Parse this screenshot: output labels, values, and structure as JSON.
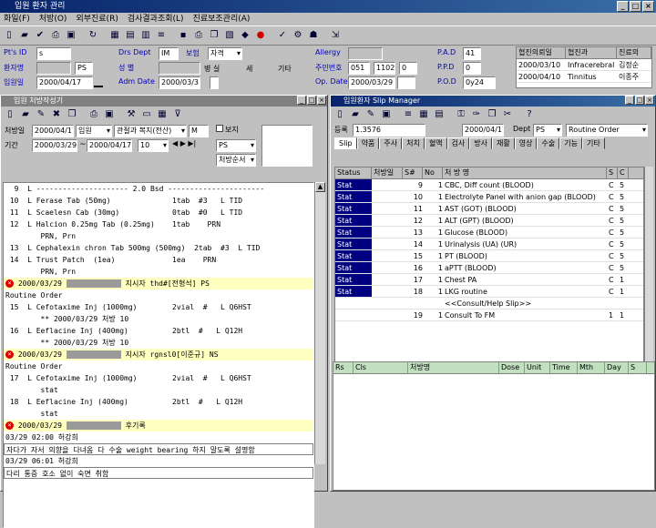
{
  "app": {
    "title": "입원 환자 관리"
  },
  "menu": [
    "화일(F)",
    "처방(O)",
    "외부진료(R)",
    "검사결과조회(L)",
    "진료보조관리(A)"
  ],
  "toolbar_icons": [
    "new-icon",
    "folder-icon",
    "check-icon",
    "print-icon",
    "save-icon",
    "refresh-icon",
    "grid-icon",
    "table-icon",
    "form-icon",
    "list-icon",
    "save-disk-icon",
    "printer-icon",
    "copy-icon",
    "chart-icon",
    "lock-icon",
    "stop-icon",
    "tick-icon",
    "settings-icon",
    "users-icon",
    "export-icon"
  ],
  "patient": {
    "ptid_label": "Pt's ID",
    "ptid_value": "s",
    "name_label": "환자명",
    "name_value": "PS",
    "adm_label": "입원일",
    "adm_value": "2000/04/17",
    "dept_label": "Drs Dept",
    "dept_value": "IM",
    "ins_label": "보험",
    "ins_value": "자격",
    "rank_label": "성 별",
    "rank_value": "",
    "room_label": "병 실",
    "room_a": "세",
    "room_b": "기타",
    "adm_date_label": "Adm Date",
    "adm_date_value": "2000/03/3",
    "allergy_label": "Allergy",
    "allergy_value": "",
    "reg_label": "주민번호",
    "reg_a": "051",
    "reg_b": "1102",
    "reg_c": "0",
    "opdate_label": "Op. Date",
    "opdate_value": "2000/03/29",
    "pad_label": "P.A.D",
    "pad_value": "41",
    "pod_label": "P.P.D",
    "pod_value": "0",
    "ppd_label": "P.O.D",
    "ppd_value": "0y24"
  },
  "consult": {
    "headers": [
      "협진의뢰일",
      "협진과",
      "진료의"
    ],
    "rows": [
      [
        "2000/03/10",
        "Infracerebral",
        "김정순"
      ],
      [
        "2000/04/10",
        "Tinnitus",
        "이종주"
      ]
    ]
  },
  "left_panel": {
    "title": "입원 처방작성기",
    "date_label": "처방일",
    "date_value": "2000/04/17",
    "type_value": "입원",
    "dept_value": "관절과 복지(전산)",
    "status_value": "M",
    "range_label": "기간",
    "range_from": "2000/03/29",
    "range_to": "2000/04/17",
    "count_value": "10",
    "sel_value": "PS",
    "mode_value": "처방순서",
    "chk_label": "보지",
    "orders": [
      {
        "t": "  9  L --------------------- 2.0 Bsd ----------------------",
        "kind": "plain"
      },
      {
        "t": " 10  L Ferase Tab (50mg)              1tab  #3   L TID",
        "kind": "plain"
      },
      {
        "t": " 11  L Scaelesn Cab (30mg)            0tab  #0   L TID",
        "kind": "plain"
      },
      {
        "t": " 12  L Halcion 0.25mg Tab (0.25mg)    1tab    PRN",
        "kind": "plain"
      },
      {
        "t": "        PRN, Prn",
        "kind": "plain"
      },
      {
        "t": " 13  L Cephalexin chron Tab 500mg (500mg)  2tab  #3  L TID",
        "kind": "plain"
      },
      {
        "t": " 14  L Trust Patch  (1ea)             1ea    PRN",
        "kind": "plain"
      },
      {
        "t": "        PRN, Prn",
        "kind": "plain"
      },
      {
        "t": "2000/03/29",
        "kind": "hdr",
        "tail": "지시자 thd#[전형석] PS"
      },
      {
        "t": "Routine Order",
        "kind": "plain"
      },
      {
        "t": " 15  L Cefotaxime Inj (1000mg)        2vial  #   L Q6HST",
        "kind": "plain"
      },
      {
        "t": "        ** 2000/03/29 처방 10",
        "kind": "plain"
      },
      {
        "t": " 16  L Eeflacine Inj (400mg)          2btl  #   L Q12H",
        "kind": "plain"
      },
      {
        "t": "        ** 2000/03/29 처방 10",
        "kind": "plain"
      },
      {
        "t": "2000/03/29",
        "kind": "hdr",
        "tail": "지시자 rgnsl0[이준규] NS"
      },
      {
        "t": "Routine Order",
        "kind": "plain"
      },
      {
        "t": " 17  L Cefotaxime Inj (1000mg)        2vial  #   L Q6HST",
        "kind": "plain"
      },
      {
        "t": "        stat",
        "kind": "plain"
      },
      {
        "t": " 18  L Eeflacine Inj (400mg)          2btl  #   L Q12H",
        "kind": "plain"
      },
      {
        "t": "        stat",
        "kind": "plain"
      },
      {
        "t": "2000/03/29",
        "kind": "hdr",
        "tail": "후기록"
      }
    ],
    "note1_time": "03/29 02:00 허강희",
    "note1_text": "자다가 자서 의향을 다녀옴 다 수술 weight bearing 하지 말도록 설명함",
    "note2_time": "03/29 06:01 허강희",
    "note2_text": "다리 통증 호소 없이 숙면 취함"
  },
  "right_panel": {
    "title": "입원환자 Slip Manager",
    "no_label": "등록",
    "no_value": "1.3576",
    "date_value": "2000/04/17",
    "dept_label": "Dept",
    "dept_value": "PS",
    "order_value": "Routine Order",
    "tabs": [
      "Slip",
      "약품",
      "주사",
      "처치",
      "혈액",
      "검사",
      "방사",
      "재활",
      "영상",
      "수술",
      "기능",
      "기타"
    ],
    "cols": [
      "Status",
      "처방일",
      "S#",
      "No",
      "처 방 명",
      "S",
      "C"
    ],
    "rows": [
      [
        "Stat",
        "",
        "9",
        "1",
        "CBC, Diff count  (BLOOD)",
        "C",
        "5"
      ],
      [
        "Stat",
        "",
        "10",
        "1",
        "Electrolyte Panel with anion gap  (BLOOD)",
        "C",
        "5"
      ],
      [
        "Stat",
        "",
        "11",
        "1",
        "AST (GOT)  (BLOOD)",
        "C",
        "5"
      ],
      [
        "Stat",
        "",
        "12",
        "1",
        "ALT (GPT)  (BLOOD)",
        "C",
        "5"
      ],
      [
        "Stat",
        "",
        "13",
        "1",
        "Glucose  (BLOOD)",
        "C",
        "5"
      ],
      [
        "Stat",
        "",
        "14",
        "1",
        "Urinalysis (UA)  (UR)",
        "C",
        "5"
      ],
      [
        "Stat",
        "",
        "15",
        "1",
        "PT  (BLOOD)",
        "C",
        "5"
      ],
      [
        "Stat",
        "",
        "16",
        "1",
        "aPTT  (BLOOD)",
        "C",
        "5"
      ],
      [
        "Stat",
        "",
        "17",
        "1",
        "Chest PA",
        "C",
        "1"
      ],
      [
        "Stat",
        "",
        "18",
        "1",
        "LKG routine",
        "C",
        "1"
      ],
      [
        "",
        "",
        "",
        "",
        "<<Consult/Help Slip>>",
        "",
        ""
      ],
      [
        "",
        "",
        "19",
        "1",
        "Consult To FM",
        "1",
        "1"
      ]
    ],
    "bottom_cols": [
      "Rs",
      "Cls",
      "처방명",
      "Dose",
      "Unit",
      "Time",
      "Mth",
      "Day",
      "S"
    ]
  }
}
